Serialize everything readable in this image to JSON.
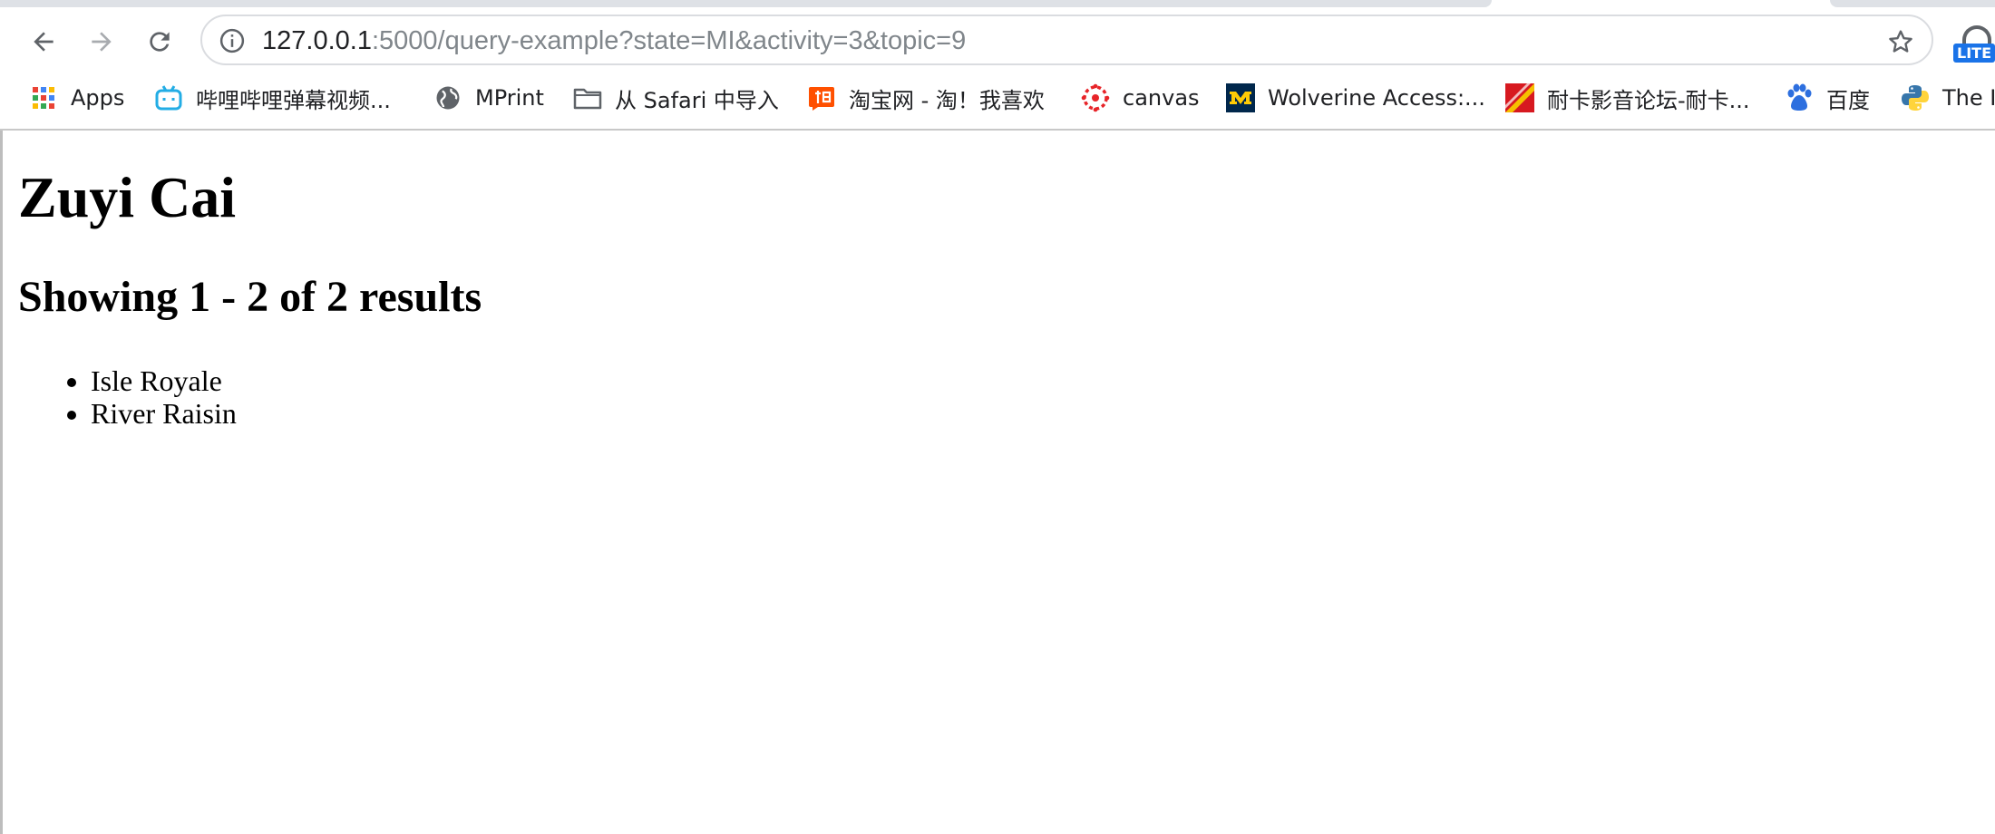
{
  "browser": {
    "url_host": "127.0.0.1",
    "url_rest": ":5000/query-example?state=MI&activity=3&topic=9",
    "extension_badge": "LITE",
    "bookmarks": [
      {
        "label": "Apps",
        "icon": "apps-grid-icon"
      },
      {
        "label": "哔哩哔哩弹幕视频...",
        "icon": "bilibili-icon"
      },
      {
        "label": "MPrint",
        "icon": "globe-icon"
      },
      {
        "label": "从 Safari 中导入",
        "icon": "folder-icon"
      },
      {
        "label": "淘宝网 - 淘！我喜欢",
        "icon": "taobao-icon"
      },
      {
        "label": "canvas",
        "icon": "canvas-icon"
      },
      {
        "label": "Wolverine Access:...",
        "icon": "umich-m-icon"
      },
      {
        "label": "耐卡影音论坛-耐卡...",
        "icon": "naika-icon"
      },
      {
        "label": "百度",
        "icon": "baidu-paw-icon"
      },
      {
        "label": "The I",
        "icon": "python-icon"
      }
    ]
  },
  "page": {
    "title": "Zuyi Cai",
    "results_heading": "Showing 1 - 2 of 2 results",
    "results": [
      "Isle Royale",
      "River Raisin"
    ]
  },
  "colors": {
    "url_host": "#202124",
    "url_rest": "#80868b",
    "link_blue": "#1a73e8"
  }
}
